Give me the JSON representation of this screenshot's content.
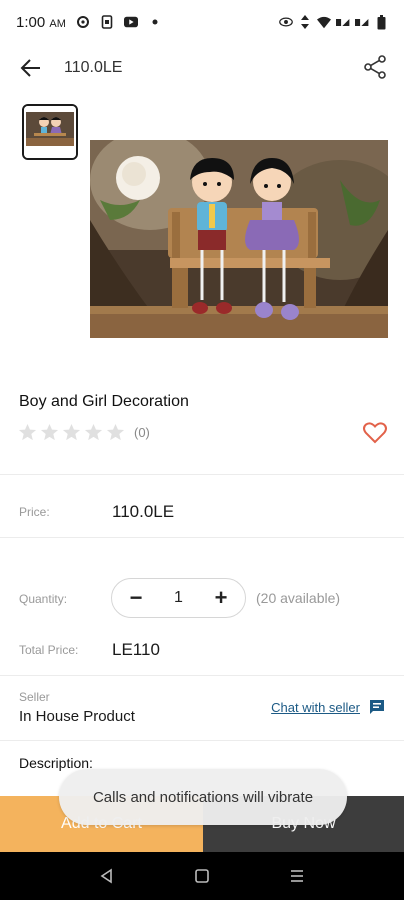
{
  "status_bar": {
    "time": "1:00",
    "ampm": "AM",
    "icons": [
      "settings-icon",
      "phone-icon",
      "youtube-icon",
      "dot-icon",
      "eye-icon",
      "data-arrows-icon",
      "wifi-icon",
      "signal-icon",
      "signal-icon",
      "battery-icon"
    ]
  },
  "header": {
    "title": "110.0LE",
    "back_icon": "arrow-left-icon",
    "share_icon": "share-icon"
  },
  "product": {
    "name": "Boy and Girl Decoration",
    "rating_count": "(0)",
    "rating": 0,
    "rating_max": 5,
    "wishlist_icon": "heart-outline-icon"
  },
  "price_row": {
    "label": "Price:",
    "value": "110.0LE"
  },
  "quantity_row": {
    "label": "Quantity:",
    "minus": "−",
    "value": "1",
    "plus": "+",
    "available": "(20 available)"
  },
  "total_row": {
    "label": "Total Price:",
    "value": "LE110"
  },
  "seller": {
    "label": "Seller",
    "name": "In House Product",
    "chat_label": "Chat with seller",
    "chat_icon": "chat-icon"
  },
  "description": {
    "title": "Description:"
  },
  "actions": {
    "add_to_cart": "Add to Cart",
    "buy_now": "Buy Now"
  },
  "toast": {
    "message": "Calls and notifications will vibrate"
  },
  "nav": {
    "back_icon": "nav-back-icon",
    "home_icon": "nav-home-icon",
    "recents_icon": "nav-recents-icon"
  },
  "colors": {
    "accent_orange": "#f4b35d",
    "dark_button": "#3d3d3d",
    "heart": "#e2624a",
    "link": "#1c5a85"
  }
}
